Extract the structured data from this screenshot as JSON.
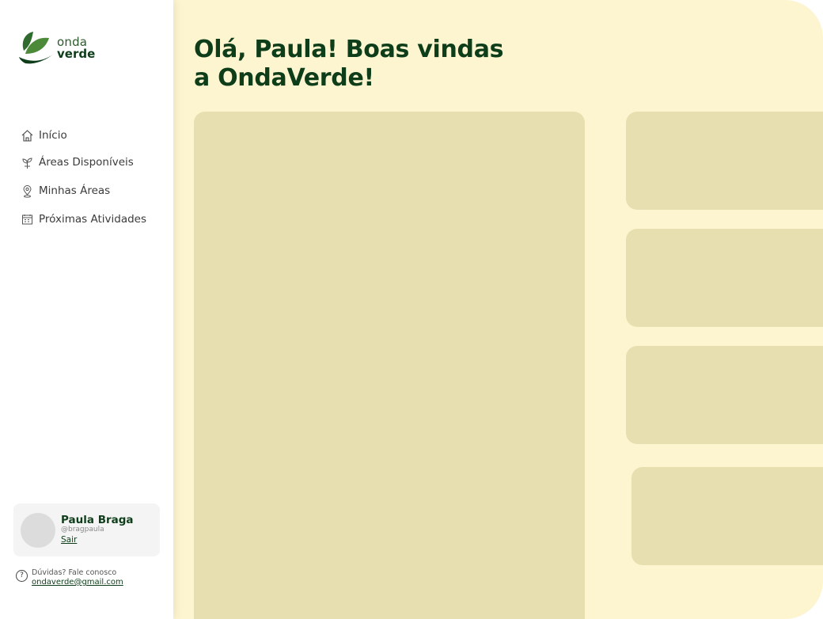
{
  "brand": {
    "line1": "onda",
    "line2": "verde"
  },
  "nav": {
    "items": [
      {
        "label": "Início",
        "icon": "home-icon"
      },
      {
        "label": "Áreas Disponíveis",
        "icon": "plant-icon"
      },
      {
        "label": "Minhas Áreas",
        "icon": "map-pin-icon"
      },
      {
        "label": "Próximas Atividades",
        "icon": "calendar-icon"
      }
    ]
  },
  "profile": {
    "name": "Paula Braga",
    "username": "@bragpaula",
    "logout": "Sair"
  },
  "help": {
    "text": "Dúvidas? Fale conosco",
    "email": "ondaverde@gmail.com"
  },
  "main": {
    "title": "Olá, Paula! Boas vindas a OndaVerde!"
  },
  "colors": {
    "brand_dark": "#0e3d1a",
    "main_bg": "#fdf5d0",
    "panel": "#e8dfb0"
  }
}
